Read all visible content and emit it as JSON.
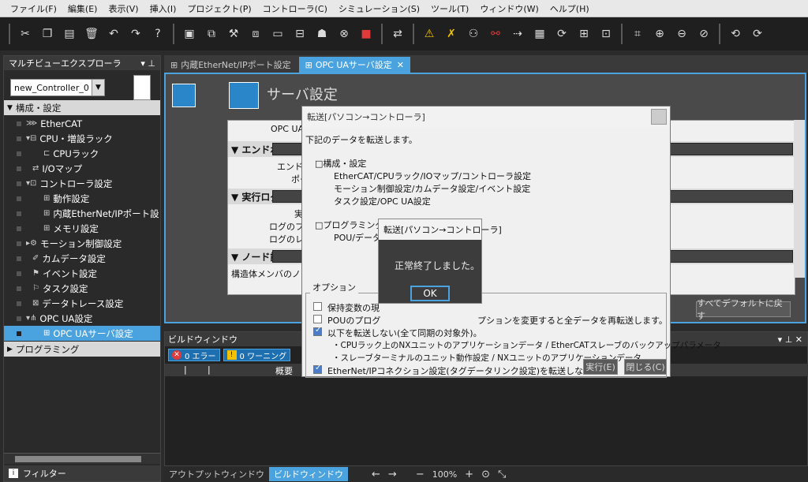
{
  "menubar": {
    "items": [
      "ファイル(F)",
      "編集(E)",
      "表示(V)",
      "挿入(I)",
      "プロジェクト(P)",
      "コントローラ(C)",
      "シミュレーション(S)",
      "ツール(T)",
      "ウィンドウ(W)",
      "ヘルプ(H)"
    ]
  },
  "explorer": {
    "title": "マルチビューエクスプローラ",
    "pin": "▾ ⊥",
    "controller": "new_Controller_0",
    "items": [
      {
        "label": "構成・設定",
        "type": "header"
      },
      {
        "label": "EtherCAT"
      },
      {
        "label": "CPU・増設ラック"
      },
      {
        "label": "CPUラック"
      },
      {
        "label": "I/Oマップ"
      },
      {
        "label": "コントローラ設定"
      },
      {
        "label": "動作設定"
      },
      {
        "label": "内蔵EtherNet/IPポート設"
      },
      {
        "label": "メモリ設定"
      },
      {
        "label": "モーション制御設定"
      },
      {
        "label": "カムデータ設定"
      },
      {
        "label": "イベント設定"
      },
      {
        "label": "タスク設定"
      },
      {
        "label": "データトレース設定"
      },
      {
        "label": "OPC UA設定"
      },
      {
        "label": "OPC UAサーバ設定",
        "selected": true
      },
      {
        "label": "プログラミング",
        "type": "header"
      }
    ],
    "filter": "フィルター"
  },
  "tabs": [
    {
      "label": "内蔵EtherNet/IPポート設定",
      "active": false
    },
    {
      "label": "OPC UAサーバ設定",
      "active": true,
      "close": "✕"
    }
  ],
  "editor": {
    "title": "サーバ設定",
    "opc_label": "OPC UA",
    "sections": [
      "▼ エンドポイント設",
      "▼ 実行ログ設定",
      "▼ ノード設定"
    ],
    "endpoint_fields": [
      "エンドポ",
      "ポー"
    ],
    "log_fields": [
      "実",
      "ログのファ",
      "ログのレコ"
    ],
    "node_field": "構造体メンバのノード",
    "defaults_button": "すべてデフォルトに戻す"
  },
  "transfer_dialog": {
    "title": "転送[パソコン→コントローラ]",
    "intro": "下記のデータを転送します。",
    "config_header": "□構成・設定",
    "config_lines": [
      "EtherCAT/CPUラック/IOマップ/コントローラ設定",
      "モーション制御設定/カムデータ設定/イベント設定",
      "タスク設定/OPC UA設定"
    ],
    "prog_header": "□プログラミング",
    "prog_line": "POU/データ/",
    "options_label": "オプション",
    "options": [
      {
        "label": "保持変数の現",
        "checked": false
      },
      {
        "label": "POUのプログ",
        "checked": false
      },
      {
        "label": "以下を転送しない(全て同期の対象外)。",
        "checked": true
      },
      {
        "label": "EtherNet/IPコネクション設定(タグデータリンク設定)を転送しない。",
        "checked": true
      }
    ],
    "option_note": "プションを変更すると全データを再転送します。",
    "sub_lines": [
      "・CPUラック上のNXユニットのアプリケーションデータ / EtherCATスレーブのバックアップパラメータ",
      "・スレーブターミナルのユニット動作設定 / NXユニットのアプリケーションデータ"
    ],
    "execute_button": "実行(E)",
    "close_button": "閉じる(C)"
  },
  "complete_dialog": {
    "title": "転送[パソコン→コントローラ]",
    "message": "正常終了しました。",
    "ok": "OK"
  },
  "build": {
    "title": "ビルドウィンドウ",
    "pin": "▾ ⊥ ✕",
    "errors": "0 エラー",
    "warnings": "0 ワーニング",
    "col_summary": "概要"
  },
  "bottom": {
    "tabs": [
      "アウトプットウィンドウ",
      "ビルドウィンドウ"
    ],
    "zoom": "100%"
  }
}
